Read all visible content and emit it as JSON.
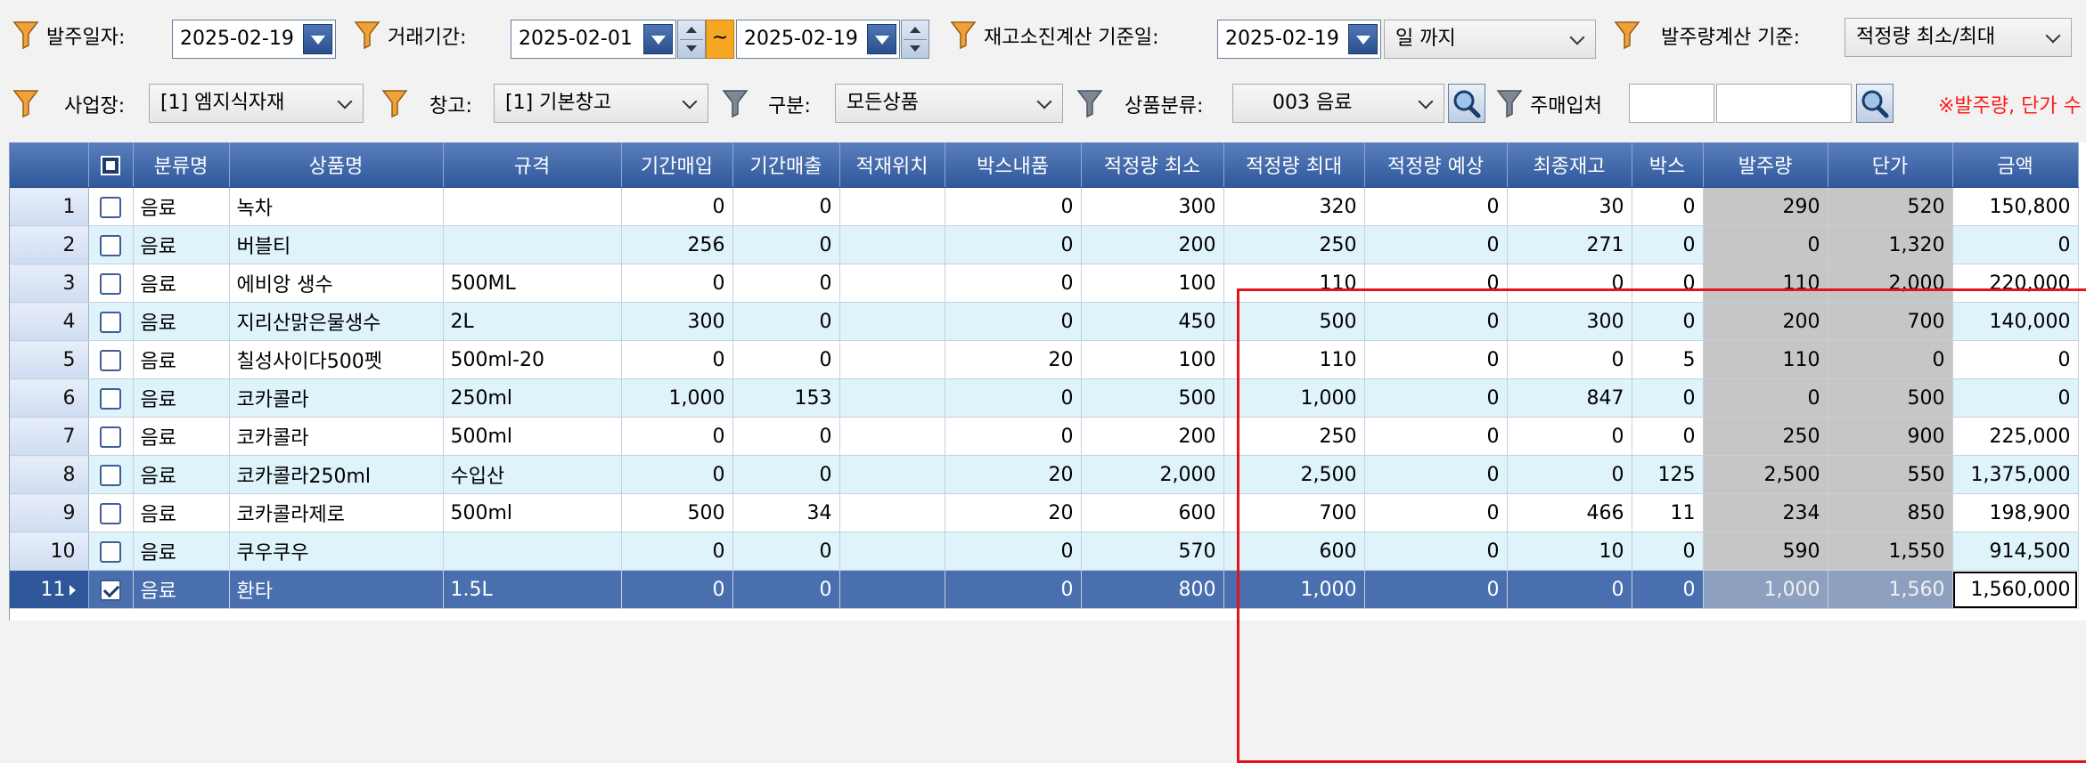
{
  "filters_row1": {
    "order_date_label": "발주일자:",
    "order_date_value": "2025-02-19",
    "trade_period_label": "거래기간:",
    "trade_period_from": "2025-02-01",
    "trade_period_tilde": "~",
    "trade_period_to": "2025-02-19",
    "stock_calc_label": "재고소진계산 기준일:",
    "stock_calc_date": "2025-02-19",
    "until_value": "일 까지",
    "order_qty_label": "발주량계산 기준:",
    "order_qty_value": "적정량 최소/최대"
  },
  "filters_row2": {
    "site_label": "사업장:",
    "site_value": "[1] 엠지식자재",
    "warehouse_label": "창고:",
    "warehouse_value": "[1] 기본창고",
    "category_label": "구분:",
    "category_value": "모든상품",
    "product_class_label": "상품분류:",
    "product_class_value": "003 음료",
    "supplier_label": "주매입처",
    "supplier_code": "",
    "supplier_name": "",
    "notice": "※발주량, 단가 수"
  },
  "grid": {
    "columns": [
      "분류명",
      "상품명",
      "규격",
      "기간매입",
      "기간매출",
      "적재위치",
      "박스내품",
      "적정량 최소",
      "적정량 최대",
      "적정량 예상",
      "최종재고",
      "박스",
      "발주량",
      "단가",
      "금액"
    ],
    "rows": [
      {
        "no": "1",
        "checked": false,
        "cat": "음료",
        "name": "녹차",
        "spec": "",
        "buy": "0",
        "sell": "0",
        "loc": "",
        "boxqty": "0",
        "min": "300",
        "max": "320",
        "expect": "0",
        "stock": "30",
        "box": "0",
        "order": "290",
        "price": "520",
        "amount": "150,800"
      },
      {
        "no": "2",
        "checked": false,
        "cat": "음료",
        "name": "버블티",
        "spec": "",
        "buy": "256",
        "sell": "0",
        "loc": "",
        "boxqty": "0",
        "min": "200",
        "max": "250",
        "expect": "0",
        "stock": "271",
        "box": "0",
        "order": "0",
        "price": "1,320",
        "amount": "0"
      },
      {
        "no": "3",
        "checked": false,
        "cat": "음료",
        "name": "에비앙 생수",
        "spec": "500ML",
        "buy": "0",
        "sell": "0",
        "loc": "",
        "boxqty": "0",
        "min": "100",
        "max": "110",
        "expect": "0",
        "stock": "0",
        "box": "0",
        "order": "110",
        "price": "2,000",
        "amount": "220,000"
      },
      {
        "no": "4",
        "checked": false,
        "cat": "음료",
        "name": "지리산맑은물생수",
        "spec": "2L",
        "buy": "300",
        "sell": "0",
        "loc": "",
        "boxqty": "0",
        "min": "450",
        "max": "500",
        "expect": "0",
        "stock": "300",
        "box": "0",
        "order": "200",
        "price": "700",
        "amount": "140,000"
      },
      {
        "no": "5",
        "checked": false,
        "cat": "음료",
        "name": "칠성사이다500펫",
        "spec": "500ml-20",
        "buy": "0",
        "sell": "0",
        "loc": "",
        "boxqty": "20",
        "min": "100",
        "max": "110",
        "expect": "0",
        "stock": "0",
        "box": "5",
        "order": "110",
        "price": "0",
        "amount": "0"
      },
      {
        "no": "6",
        "checked": false,
        "cat": "음료",
        "name": "코카콜라",
        "spec": "250ml",
        "buy": "1,000",
        "sell": "153",
        "loc": "",
        "boxqty": "0",
        "min": "500",
        "max": "1,000",
        "expect": "0",
        "stock": "847",
        "box": "0",
        "order": "0",
        "price": "500",
        "amount": "0"
      },
      {
        "no": "7",
        "checked": false,
        "cat": "음료",
        "name": "코카콜라",
        "spec": "500ml",
        "buy": "0",
        "sell": "0",
        "loc": "",
        "boxqty": "0",
        "min": "200",
        "max": "250",
        "expect": "0",
        "stock": "0",
        "box": "0",
        "order": "250",
        "price": "900",
        "amount": "225,000"
      },
      {
        "no": "8",
        "checked": false,
        "cat": "음료",
        "name": "코카콜라250ml",
        "spec": "수입산",
        "buy": "0",
        "sell": "0",
        "loc": "",
        "boxqty": "20",
        "min": "2,000",
        "max": "2,500",
        "expect": "0",
        "stock": "0",
        "box": "125",
        "order": "2,500",
        "price": "550",
        "amount": "1,375,000"
      },
      {
        "no": "9",
        "checked": false,
        "cat": "음료",
        "name": "코카콜라제로",
        "spec": "500ml",
        "buy": "500",
        "sell": "34",
        "loc": "",
        "boxqty": "20",
        "min": "600",
        "max": "700",
        "expect": "0",
        "stock": "466",
        "box": "11",
        "order": "234",
        "price": "850",
        "amount": "198,900"
      },
      {
        "no": "10",
        "checked": false,
        "cat": "음료",
        "name": "쿠우쿠우",
        "spec": "",
        "buy": "0",
        "sell": "0",
        "loc": "",
        "boxqty": "0",
        "min": "570",
        "max": "600",
        "expect": "0",
        "stock": "10",
        "box": "0",
        "order": "590",
        "price": "1,550",
        "amount": "914,500"
      },
      {
        "no": "11",
        "checked": true,
        "selected": true,
        "cat": "음료",
        "name": "환타",
        "spec": "1.5L",
        "buy": "0",
        "sell": "0",
        "loc": "",
        "boxqty": "0",
        "min": "800",
        "max": "1,000",
        "expect": "0",
        "stock": "0",
        "box": "0",
        "order": "1,000",
        "price": "1,560",
        "amount": "1,560,000"
      }
    ]
  },
  "colors": {
    "header_blue": "#2f579a",
    "row_alt": "#dff3fb",
    "editable_gray": "#c6c6c6",
    "highlight_red": "#e3121b",
    "notice_red": "#ff1a1a"
  }
}
